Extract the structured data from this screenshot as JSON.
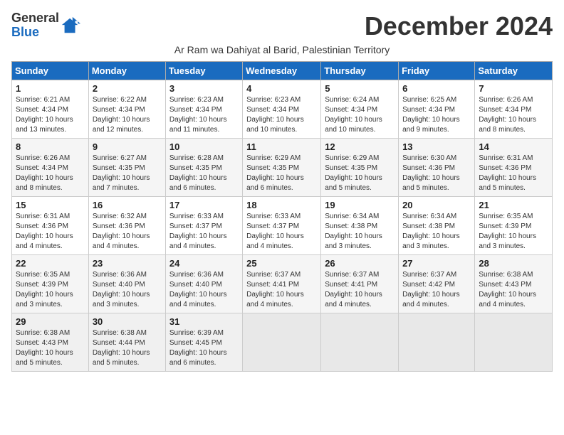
{
  "header": {
    "logo_general": "General",
    "logo_blue": "Blue",
    "month_title": "December 2024",
    "subtitle": "Ar Ram wa Dahiyat al Barid, Palestinian Territory"
  },
  "columns": [
    "Sunday",
    "Monday",
    "Tuesday",
    "Wednesday",
    "Thursday",
    "Friday",
    "Saturday"
  ],
  "weeks": [
    [
      {
        "day": "1",
        "sunrise": "6:21 AM",
        "sunset": "4:34 PM",
        "daylight": "10 hours and 13 minutes."
      },
      {
        "day": "2",
        "sunrise": "6:22 AM",
        "sunset": "4:34 PM",
        "daylight": "10 hours and 12 minutes."
      },
      {
        "day": "3",
        "sunrise": "6:23 AM",
        "sunset": "4:34 PM",
        "daylight": "10 hours and 11 minutes."
      },
      {
        "day": "4",
        "sunrise": "6:23 AM",
        "sunset": "4:34 PM",
        "daylight": "10 hours and 10 minutes."
      },
      {
        "day": "5",
        "sunrise": "6:24 AM",
        "sunset": "4:34 PM",
        "daylight": "10 hours and 10 minutes."
      },
      {
        "day": "6",
        "sunrise": "6:25 AM",
        "sunset": "4:34 PM",
        "daylight": "10 hours and 9 minutes."
      },
      {
        "day": "7",
        "sunrise": "6:26 AM",
        "sunset": "4:34 PM",
        "daylight": "10 hours and 8 minutes."
      }
    ],
    [
      {
        "day": "8",
        "sunrise": "6:26 AM",
        "sunset": "4:34 PM",
        "daylight": "10 hours and 8 minutes."
      },
      {
        "day": "9",
        "sunrise": "6:27 AM",
        "sunset": "4:35 PM",
        "daylight": "10 hours and 7 minutes."
      },
      {
        "day": "10",
        "sunrise": "6:28 AM",
        "sunset": "4:35 PM",
        "daylight": "10 hours and 6 minutes."
      },
      {
        "day": "11",
        "sunrise": "6:29 AM",
        "sunset": "4:35 PM",
        "daylight": "10 hours and 6 minutes."
      },
      {
        "day": "12",
        "sunrise": "6:29 AM",
        "sunset": "4:35 PM",
        "daylight": "10 hours and 5 minutes."
      },
      {
        "day": "13",
        "sunrise": "6:30 AM",
        "sunset": "4:36 PM",
        "daylight": "10 hours and 5 minutes."
      },
      {
        "day": "14",
        "sunrise": "6:31 AM",
        "sunset": "4:36 PM",
        "daylight": "10 hours and 5 minutes."
      }
    ],
    [
      {
        "day": "15",
        "sunrise": "6:31 AM",
        "sunset": "4:36 PM",
        "daylight": "10 hours and 4 minutes."
      },
      {
        "day": "16",
        "sunrise": "6:32 AM",
        "sunset": "4:36 PM",
        "daylight": "10 hours and 4 minutes."
      },
      {
        "day": "17",
        "sunrise": "6:33 AM",
        "sunset": "4:37 PM",
        "daylight": "10 hours and 4 minutes."
      },
      {
        "day": "18",
        "sunrise": "6:33 AM",
        "sunset": "4:37 PM",
        "daylight": "10 hours and 4 minutes."
      },
      {
        "day": "19",
        "sunrise": "6:34 AM",
        "sunset": "4:38 PM",
        "daylight": "10 hours and 3 minutes."
      },
      {
        "day": "20",
        "sunrise": "6:34 AM",
        "sunset": "4:38 PM",
        "daylight": "10 hours and 3 minutes."
      },
      {
        "day": "21",
        "sunrise": "6:35 AM",
        "sunset": "4:39 PM",
        "daylight": "10 hours and 3 minutes."
      }
    ],
    [
      {
        "day": "22",
        "sunrise": "6:35 AM",
        "sunset": "4:39 PM",
        "daylight": "10 hours and 3 minutes."
      },
      {
        "day": "23",
        "sunrise": "6:36 AM",
        "sunset": "4:40 PM",
        "daylight": "10 hours and 3 minutes."
      },
      {
        "day": "24",
        "sunrise": "6:36 AM",
        "sunset": "4:40 PM",
        "daylight": "10 hours and 4 minutes."
      },
      {
        "day": "25",
        "sunrise": "6:37 AM",
        "sunset": "4:41 PM",
        "daylight": "10 hours and 4 minutes."
      },
      {
        "day": "26",
        "sunrise": "6:37 AM",
        "sunset": "4:41 PM",
        "daylight": "10 hours and 4 minutes."
      },
      {
        "day": "27",
        "sunrise": "6:37 AM",
        "sunset": "4:42 PM",
        "daylight": "10 hours and 4 minutes."
      },
      {
        "day": "28",
        "sunrise": "6:38 AM",
        "sunset": "4:43 PM",
        "daylight": "10 hours and 4 minutes."
      }
    ],
    [
      {
        "day": "29",
        "sunrise": "6:38 AM",
        "sunset": "4:43 PM",
        "daylight": "10 hours and 5 minutes."
      },
      {
        "day": "30",
        "sunrise": "6:38 AM",
        "sunset": "4:44 PM",
        "daylight": "10 hours and 5 minutes."
      },
      {
        "day": "31",
        "sunrise": "6:39 AM",
        "sunset": "4:45 PM",
        "daylight": "10 hours and 6 minutes."
      },
      null,
      null,
      null,
      null
    ]
  ]
}
